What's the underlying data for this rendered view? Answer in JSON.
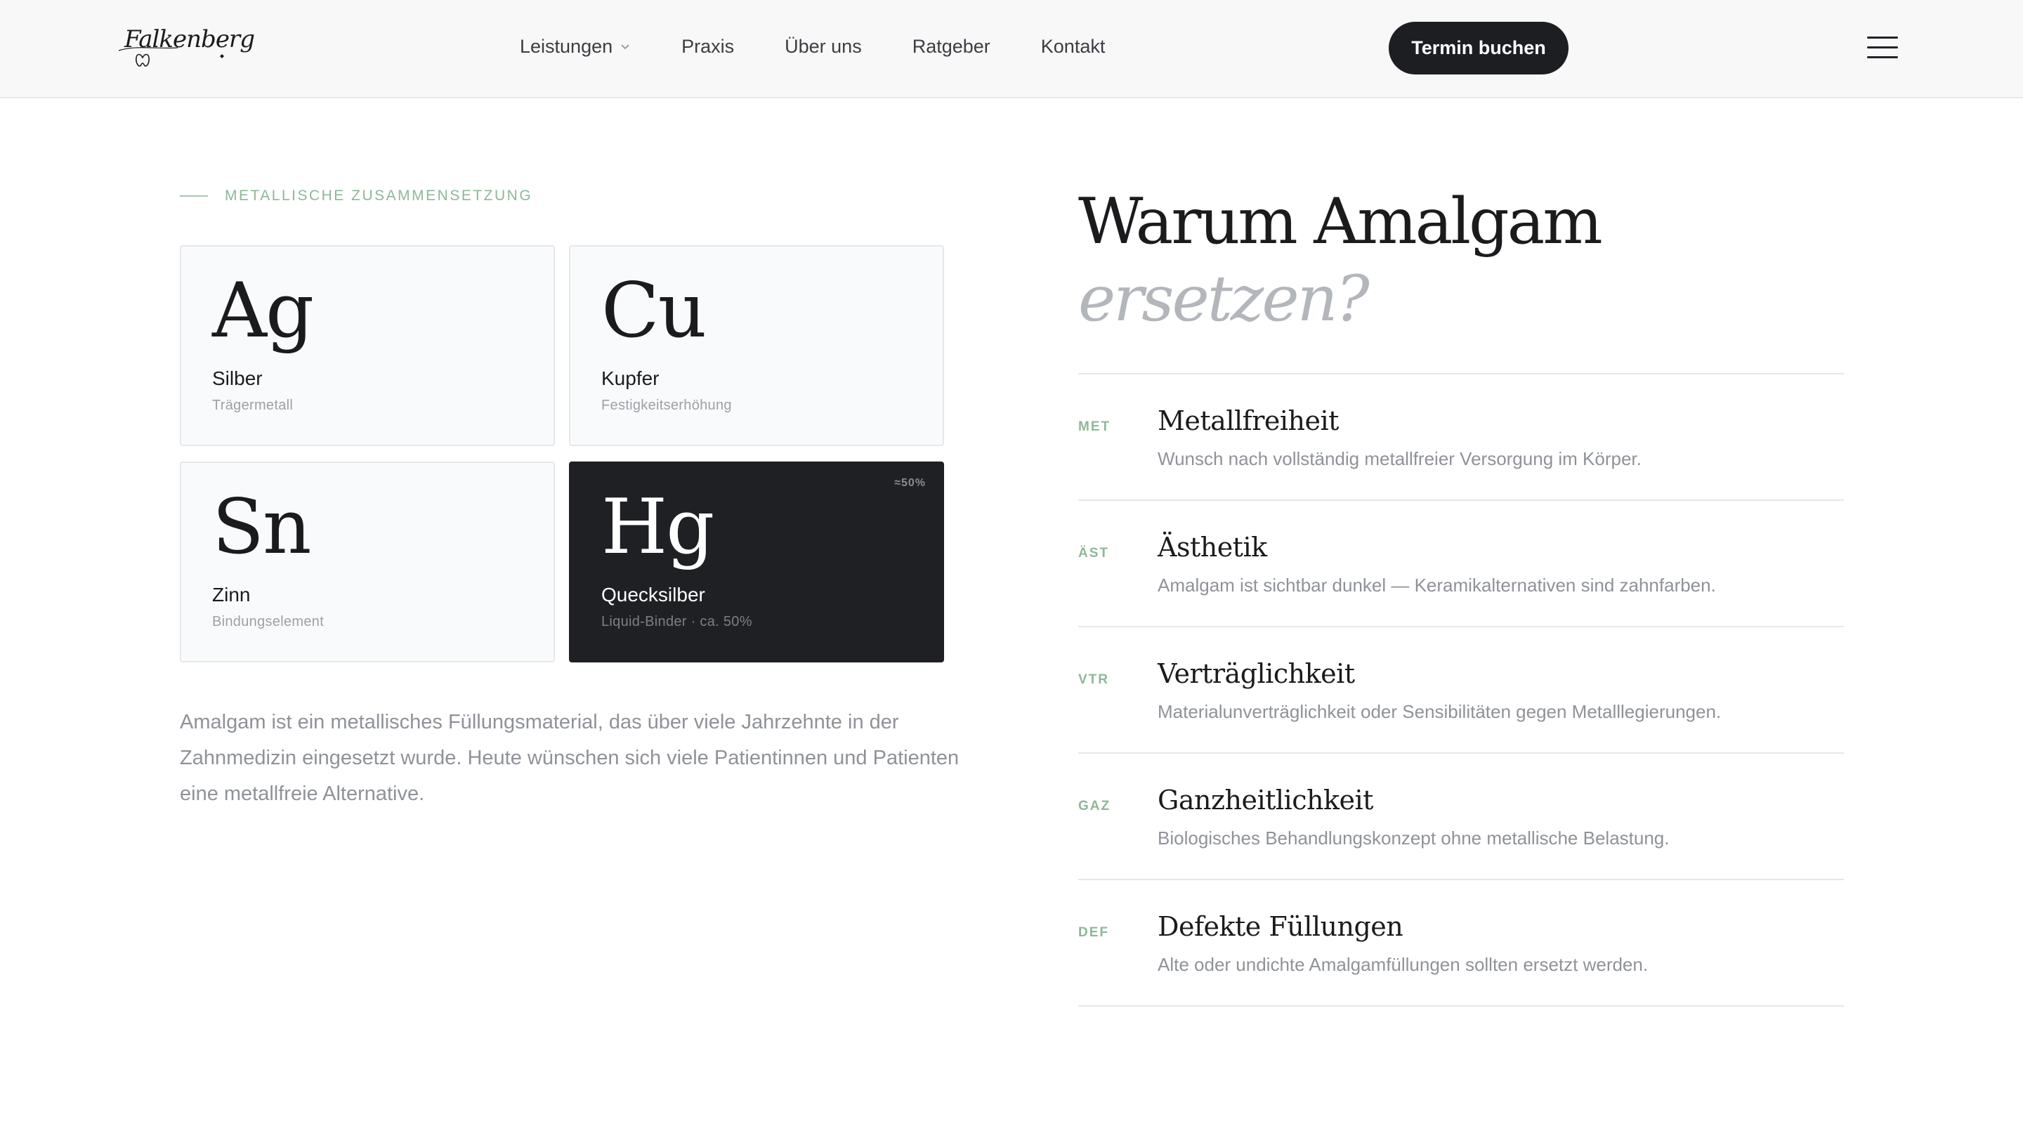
{
  "header": {
    "logo_text": "Falkenberg",
    "nav": [
      {
        "label": "Leistungen",
        "has_dropdown": true
      },
      {
        "label": "Praxis"
      },
      {
        "label": "Über uns"
      },
      {
        "label": "Ratgeber"
      },
      {
        "label": "Kontakt"
      }
    ],
    "cta_label": "Termin buchen",
    "menu_icon": "hamburger-icon"
  },
  "composition": {
    "eyebrow": "Metallische Zusammensetzung",
    "elements": [
      {
        "symbol": "Ag",
        "name": "Silber",
        "description": "Trägermetall"
      },
      {
        "symbol": "Cu",
        "name": "Kupfer",
        "description": "Festigkeitserhöhung"
      },
      {
        "symbol": "Sn",
        "name": "Zinn",
        "description": "Bindungselement"
      },
      {
        "symbol": "Hg",
        "name": "Quecksilber",
        "description": "Liquid-Binder · ca. 50%",
        "badge": "≈50%",
        "highlighted": true
      }
    ],
    "intro": "Amalgam ist ein metallisches Füllungsmaterial, das über viele Jahrzehnte in der Zahnmedizin eingesetzt wurde. Heute wünschen sich viele Patientinnen und Patienten eine metallfreie Alternative."
  },
  "why": {
    "title": "Warum Amalgam",
    "title_accent": "ersetzen?",
    "reasons": [
      {
        "code": "MET",
        "title": "Metallfreiheit",
        "description": "Wunsch nach vollständig metallfreier Versorgung im Körper."
      },
      {
        "code": "ÄST",
        "title": "Ästhetik",
        "description": "Amalgam ist sichtbar dunkel — Keramikalternativen sind zahnfarben."
      },
      {
        "code": "VTR",
        "title": "Verträglichkeit",
        "description": "Materialunverträglichkeit oder Sensibilitäten gegen Metalllegierungen."
      },
      {
        "code": "GAZ",
        "title": "Ganzheitlichkeit",
        "description": "Biologisches Behandlungskonzept ohne metallische Belastung."
      },
      {
        "code": "DEF",
        "title": "Defekte Füllungen",
        "description": "Alte oder undichte Amalgamfüllungen sollten ersetzt werden."
      }
    ]
  },
  "colors": {
    "accent_green": "#8db898",
    "dark": "#1f2024",
    "muted_text": "#8f9298"
  }
}
